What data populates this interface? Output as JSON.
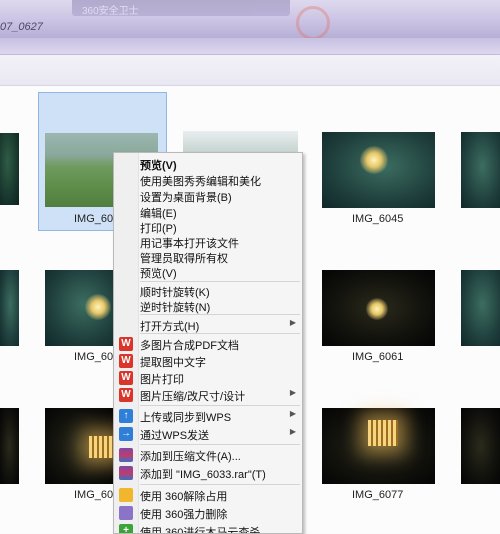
{
  "window": {
    "tab_title": "360安全卫士",
    "path": "07_0627"
  },
  "files": [
    {
      "name": "IMG_60",
      "state": "selected"
    },
    {
      "name": "IMG_6045"
    },
    {
      "name": "IMG_60"
    },
    {
      "name": "IMG_6061"
    },
    {
      "name": "IMG_60"
    },
    {
      "name": "IMG_6077"
    }
  ],
  "menu": {
    "items": [
      {
        "label": "预览(V)",
        "bold": true
      },
      {
        "label": "使用美图秀秀编辑和美化"
      },
      {
        "label": "设置为桌面背景(B)"
      },
      {
        "label": "编辑(E)"
      },
      {
        "label": "打印(P)"
      },
      {
        "label": "用记事本打开该文件"
      },
      {
        "label": "管理员取得所有权"
      },
      {
        "label": "预览(V)"
      },
      {
        "label": "顺时针旋转(K)"
      },
      {
        "label": "逆时针旋转(N)"
      },
      {
        "label": "打开方式(H)",
        "submenu": true
      },
      {
        "label": "多图片合成PDF文档",
        "icon": "wps-icon"
      },
      {
        "label": "提取图中文字",
        "icon": "wps-icon"
      },
      {
        "label": "图片打印",
        "icon": "wps-icon"
      },
      {
        "label": "图片压缩/改尺寸/设计",
        "icon": "wps-icon",
        "submenu": true
      },
      {
        "label": "上传或同步到WPS",
        "icon": "cloud-upload-icon",
        "submenu": true
      },
      {
        "label": "通过WPS发送",
        "icon": "send-arrow-icon",
        "submenu": true
      },
      {
        "label": "添加到压缩文件(A)...",
        "icon": "winrar-icon"
      },
      {
        "label": "添加到 \"IMG_6033.rar\"(T)",
        "icon": "winrar-icon"
      },
      {
        "label": "使用 360解除占用",
        "icon": "360-unlock-icon"
      },
      {
        "label": "使用 360强力删除",
        "icon": "360-delete-icon"
      },
      {
        "label": "使用 360进行木马云查杀",
        "icon": "360-scan-icon"
      }
    ]
  }
}
